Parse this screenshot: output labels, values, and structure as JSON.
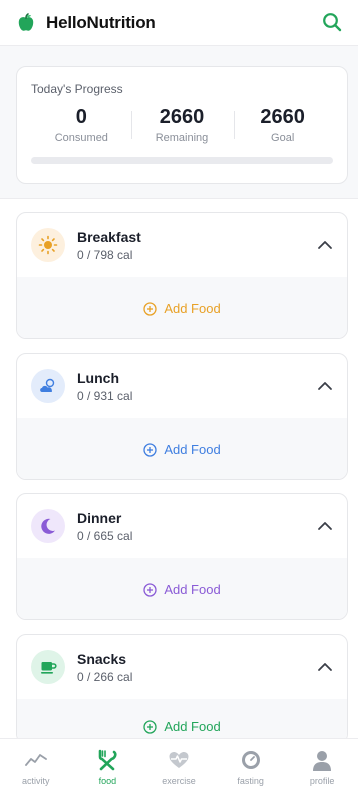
{
  "header": {
    "app_title": "HelloNutrition"
  },
  "progress": {
    "title": "Today's Progress",
    "stats": [
      {
        "value": "0",
        "label": "Consumed"
      },
      {
        "value": "2660",
        "label": "Remaining"
      },
      {
        "value": "2660",
        "label": "Goal"
      }
    ],
    "fraction": 0.0
  },
  "meals": [
    {
      "name": "Breakfast",
      "cal": "0 / 798 cal",
      "add_label": "Add Food",
      "color": "#e8a126",
      "icon": "sun-icon"
    },
    {
      "name": "Lunch",
      "cal": "0 / 931 cal",
      "add_label": "Add Food",
      "color": "#3f7ee0",
      "icon": "partly-cloudy-icon"
    },
    {
      "name": "Dinner",
      "cal": "0 / 665 cal",
      "add_label": "Add Food",
      "color": "#8a5bd6",
      "icon": "moon-icon"
    },
    {
      "name": "Snacks",
      "cal": "0 / 266 cal",
      "add_label": "Add Food",
      "color": "#22a55a",
      "icon": "cup-icon"
    }
  ],
  "nav": [
    {
      "label": "activity",
      "icon": "activity-icon",
      "active": false
    },
    {
      "label": "food",
      "icon": "utensils-icon",
      "active": true
    },
    {
      "label": "exercise",
      "icon": "heartbeat-icon",
      "active": false
    },
    {
      "label": "fasting",
      "icon": "timer-icon",
      "active": false
    },
    {
      "label": "profile",
      "icon": "user-icon",
      "active": false
    }
  ],
  "colors": {
    "brand": "#22a55a"
  }
}
